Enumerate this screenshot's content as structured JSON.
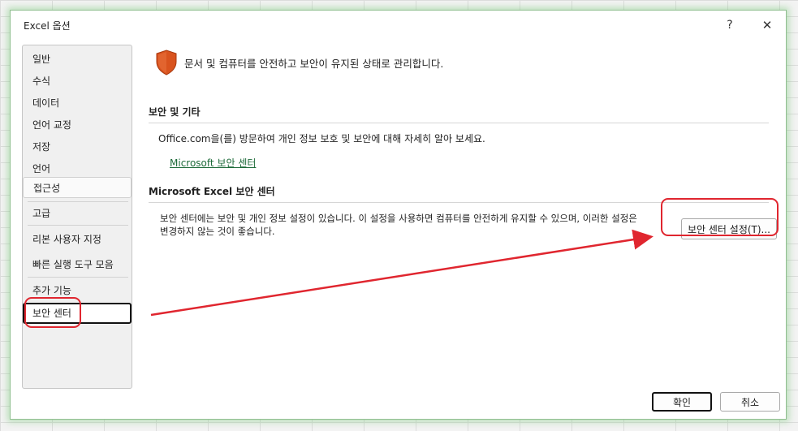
{
  "window": {
    "title": "Excel 옵션",
    "help_label": "?",
    "close_label": "✕"
  },
  "sidebar": {
    "items": [
      {
        "label": "일반"
      },
      {
        "label": "수식"
      },
      {
        "label": "데이터"
      },
      {
        "label": "언어 교정"
      },
      {
        "label": "저장"
      },
      {
        "label": "언어"
      },
      {
        "label": "접근성"
      },
      {
        "label": "고급"
      },
      {
        "label": "리본 사용자 지정"
      },
      {
        "label": "빠른 실행 도구 모음"
      },
      {
        "label": "추가 기능"
      },
      {
        "label": "보안 센터"
      }
    ],
    "selected": "보안 센터"
  },
  "main": {
    "header_text": "문서 및 컴퓨터를 안전하고 보안이 유지된 상태로 관리합니다.",
    "section1": {
      "title": "보안 및 기타",
      "text": "Office.com을(를) 방문하여 개인 정보 보호 및 보안에 대해 자세히 알아 보세요.",
      "link": "Microsoft 보안 센터"
    },
    "section2": {
      "title": "Microsoft Excel 보안 센터",
      "description": "보안 센터에는 보안 및 개인 정보 설정이 있습니다. 이 설정을 사용하면 컴퓨터를 안전하게 유지할 수 있으며, 이러한 설정은 변경하지 않는 것이 좋습니다.",
      "button_label": "보안 센터 설정(T)..."
    }
  },
  "footer": {
    "ok_label": "확인",
    "cancel_label": "취소"
  },
  "colors": {
    "shield": "#d9531e",
    "annotation": "#e0262f",
    "link": "#1e6b3a"
  }
}
